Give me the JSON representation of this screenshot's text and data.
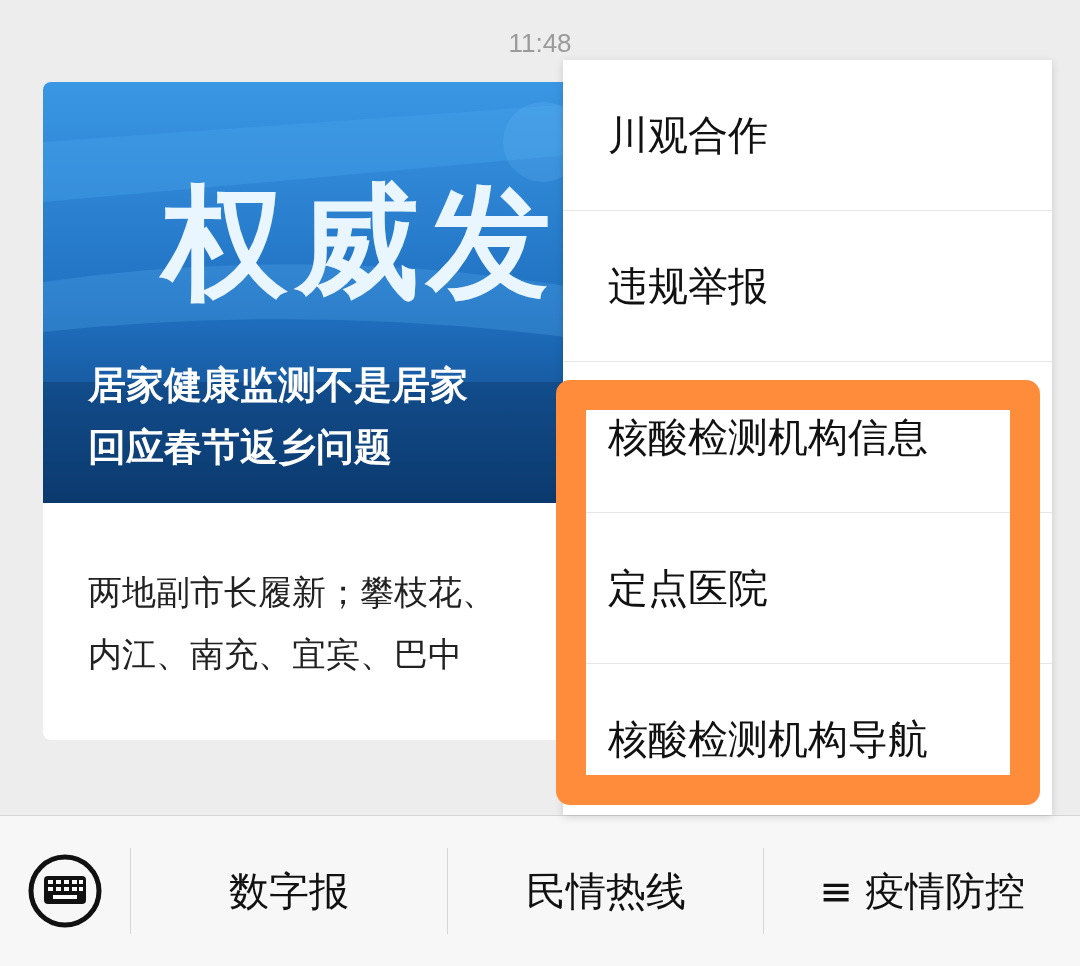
{
  "status_bar": {
    "time": "11:48"
  },
  "article_card": {
    "cover": {
      "kind": "picture",
      "caption": "权威发"
    },
    "title_lines": [
      "居家健康监测不是居家",
      "回应春节返乡问题"
    ],
    "summary_lines": [
      "两地副市长履新；攀枝花、",
      "内江、南充、宜宾、巴中"
    ]
  },
  "popup_menu": {
    "items": [
      {
        "label": "川观合作",
        "highlighted": false
      },
      {
        "label": "违规举报",
        "highlighted": false
      },
      {
        "label": "核酸检测机构信息",
        "highlighted": true
      },
      {
        "label": "定点医院",
        "highlighted": true
      },
      {
        "label": "核酸检测机构导航",
        "highlighted": true
      }
    ]
  },
  "bottom_bar": {
    "items": [
      {
        "label": "数字报"
      },
      {
        "label": "民情热线"
      },
      {
        "label": "疫情防控",
        "glyph": "≡"
      }
    ]
  }
}
